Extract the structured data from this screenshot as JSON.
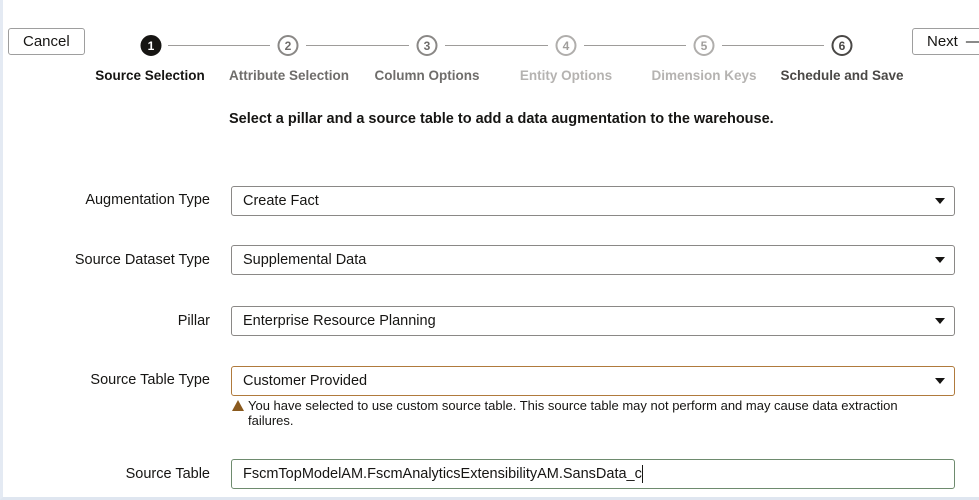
{
  "toolbar": {
    "cancel_label": "Cancel",
    "next_label": "Next"
  },
  "steps": [
    {
      "number": "1",
      "label": "Source Selection",
      "state": "active"
    },
    {
      "number": "2",
      "label": "Attribute Selection",
      "state": "enabled"
    },
    {
      "number": "3",
      "label": "Column Options",
      "state": "enabled"
    },
    {
      "number": "4",
      "label": "Entity Options",
      "state": "disabled"
    },
    {
      "number": "5",
      "label": "Dimension Keys",
      "state": "disabled"
    },
    {
      "number": "6",
      "label": "Schedule and Save",
      "state": "enabled"
    }
  ],
  "heading": "Select a pillar and a source table to add a data augmentation to the warehouse.",
  "form": {
    "augmentation_type": {
      "label": "Augmentation Type",
      "value": "Create Fact"
    },
    "source_dataset_type": {
      "label": "Source Dataset Type",
      "value": "Supplemental Data"
    },
    "pillar": {
      "label": "Pillar",
      "value": "Enterprise Resource Planning"
    },
    "source_table_type": {
      "label": "Source Table Type",
      "value": "Customer Provided",
      "warning": "You have selected to use custom source table. This source table may not perform and may cause data extraction failures."
    },
    "source_table": {
      "label": "Source Table",
      "value": "FscmTopModelAM.FscmAnalyticsExtensibilityAM.SansData_c"
    }
  },
  "colors": {
    "warning": "#8a5a1e",
    "active_border": "#b07a3c",
    "focus_border": "#6e8b6e"
  }
}
